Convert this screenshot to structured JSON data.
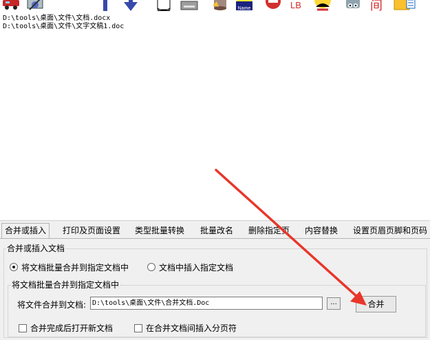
{
  "toolbar": {
    "icons": [
      "car-icon",
      "gear-tool-icon",
      "up-arrow-icon",
      "down-arrow-icon",
      "new-document-icon",
      "printer-icon",
      "database-icon",
      "name-badge-icon",
      "stop-icon",
      "label-icon",
      "face-icon",
      "robot-icon",
      "header-icon",
      "folder-icon"
    ],
    "name_badge_text": "Name",
    "label_icon_text": "LB",
    "header_icon_text": "间"
  },
  "file_list": {
    "items": [
      "D:\\tools\\桌面\\文件\\文档.docx",
      "D:\\tools\\桌面\\文件\\文字文稿1.doc"
    ]
  },
  "tabs": [
    "合并或插入",
    "打印及页面设置",
    "类型批量转换",
    "批量改名",
    "删除指定页",
    "内容替换",
    "设置页眉页脚和页码"
  ],
  "active_tab": "合并或插入",
  "merge_section": {
    "title": "合并或插入文档",
    "option_merge": "将文档批量合并到指定文档中",
    "option_insert": "文档中插入指定文档",
    "group_title": "将文档批量合并到指定文档中",
    "field_label": "将文件合并到文档:",
    "target_path": "D:\\tools\\桌面\\文件\\合并文档.Doc",
    "browse_label": "...",
    "merge_button": "合并",
    "checkbox_open_after": "合并完成后打开新文档",
    "checkbox_page_break": "在合并文档间插入分页符"
  },
  "colors": {
    "annotation_arrow": "#e8362a",
    "panel_background": "#f0f0f0"
  }
}
